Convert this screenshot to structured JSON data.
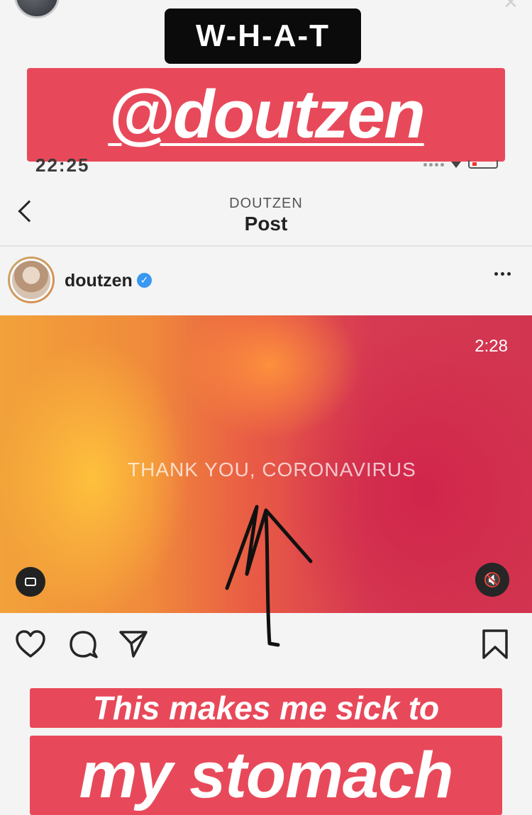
{
  "story": {
    "sticker_top": "W-H-A-T",
    "mention": "@doutzen",
    "caption_line1": "This makes me sick to",
    "caption_line2": "my stomach",
    "close_symbol": "×"
  },
  "status_bar": {
    "time": "22:25"
  },
  "screen_header": {
    "username": "DOUTZEN",
    "title": "Post"
  },
  "post": {
    "author": "doutzen",
    "verified": true,
    "video_timer": "2:28",
    "video_text": "THANK YOU, CORONAVIRUS"
  },
  "colors": {
    "sticker_red": "#e8495a",
    "sticker_black": "#0b0b0b",
    "verified_blue": "#3897f0"
  },
  "icons": [
    "back-chevron-icon",
    "verified-icon",
    "more-icon",
    "igtv-icon",
    "mute-icon",
    "heart-icon",
    "comment-icon",
    "share-icon",
    "bookmark-icon"
  ]
}
